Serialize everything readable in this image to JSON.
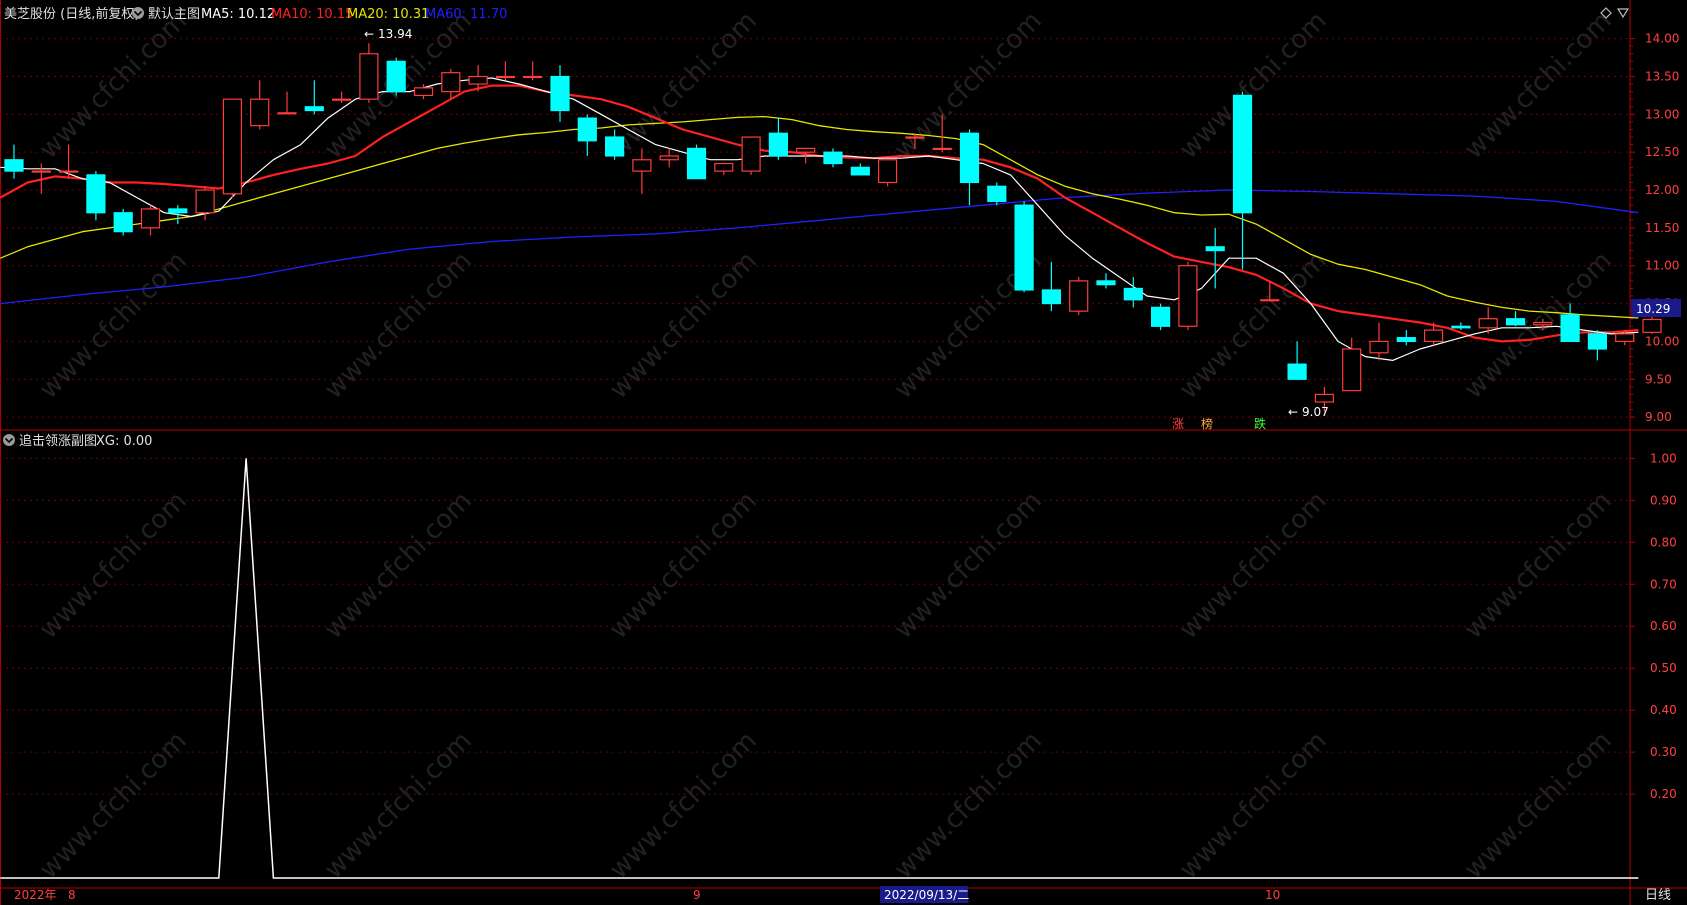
{
  "main_panel": {
    "stock_title": "美芝股份 (日线,前复权)",
    "template_label": "默认主图",
    "ma5": "MA5: 10.12",
    "ma10": "MA10: 10.15",
    "ma20": "MA20: 10.31",
    "ma60": "MA60: 11.70",
    "current_price_tag": "10.29",
    "high_marker": "13.94",
    "low_marker": "9.07",
    "signals": [
      "涨",
      "榜",
      "跌"
    ]
  },
  "sub_panel": {
    "title": "追击领涨副图",
    "value_label": "XG: 0.00"
  },
  "x_axis": {
    "labels": [
      "2022年",
      "8",
      "9",
      "10"
    ],
    "highlight_date": "2022/09/13/二",
    "period_button": "日线"
  },
  "watermark": "www.cfchi.com",
  "colors": {
    "up": "#ff3b3b",
    "down": "#00ffff",
    "ma5": "#ffffff",
    "ma10": "#ff2020",
    "ma20": "#e6e600",
    "ma60": "#2020ff",
    "axis": "#b40000",
    "grid": "#6e0000"
  },
  "chart_data": [
    {
      "type": "candlestick",
      "y_ticks": [
        14.0,
        13.5,
        13.0,
        12.5,
        12.0,
        11.5,
        11.0,
        10.5,
        10.0,
        9.5,
        9.0
      ],
      "ylim": [
        8.83,
        14.18
      ],
      "candles": [
        {
          "o": 12.4,
          "h": 12.6,
          "l": 12.15,
          "c": 12.25
        },
        {
          "o": 12.25,
          "h": 12.35,
          "l": 11.95,
          "c": 12.25
        },
        {
          "o": 12.25,
          "h": 12.6,
          "l": 12.15,
          "c": 12.25
        },
        {
          "o": 12.2,
          "h": 12.25,
          "l": 11.6,
          "c": 11.7
        },
        {
          "o": 11.7,
          "h": 11.75,
          "l": 11.4,
          "c": 11.45
        },
        {
          "o": 11.5,
          "h": 11.8,
          "l": 11.4,
          "c": 11.75
        },
        {
          "o": 11.75,
          "h": 11.8,
          "l": 11.55,
          "c": 11.7
        },
        {
          "o": 11.7,
          "h": 12.05,
          "l": 11.6,
          "c": 12.0
        },
        {
          "o": 11.95,
          "h": 13.2,
          "l": 11.9,
          "c": 13.2
        },
        {
          "o": 12.85,
          "h": 13.45,
          "l": 12.8,
          "c": 13.2
        },
        {
          "o": 13.02,
          "h": 13.3,
          "l": 13.0,
          "c": 13.02
        },
        {
          "o": 13.1,
          "h": 13.45,
          "l": 13.0,
          "c": 13.05
        },
        {
          "o": 13.2,
          "h": 13.3,
          "l": 13.15,
          "c": 13.2
        },
        {
          "o": 13.2,
          "h": 13.94,
          "l": 13.15,
          "c": 13.8
        },
        {
          "o": 13.7,
          "h": 13.75,
          "l": 13.25,
          "c": 13.3
        },
        {
          "o": 13.25,
          "h": 13.4,
          "l": 13.2,
          "c": 13.35
        },
        {
          "o": 13.3,
          "h": 13.6,
          "l": 13.2,
          "c": 13.55
        },
        {
          "o": 13.4,
          "h": 13.65,
          "l": 13.3,
          "c": 13.5
        },
        {
          "o": 13.5,
          "h": 13.7,
          "l": 13.45,
          "c": 13.5
        },
        {
          "o": 13.5,
          "h": 13.7,
          "l": 13.45,
          "c": 13.5
        },
        {
          "o": 13.5,
          "h": 13.65,
          "l": 12.9,
          "c": 13.05
        },
        {
          "o": 12.95,
          "h": 13.0,
          "l": 12.45,
          "c": 12.65
        },
        {
          "o": 12.7,
          "h": 12.8,
          "l": 12.4,
          "c": 12.45
        },
        {
          "o": 12.25,
          "h": 12.55,
          "l": 11.95,
          "c": 12.4
        },
        {
          "o": 12.4,
          "h": 12.55,
          "l": 12.3,
          "c": 12.45
        },
        {
          "o": 12.55,
          "h": 12.6,
          "l": 12.15,
          "c": 12.15
        },
        {
          "o": 12.25,
          "h": 12.3,
          "l": 12.2,
          "c": 12.35
        },
        {
          "o": 12.25,
          "h": 12.7,
          "l": 12.2,
          "c": 12.7
        },
        {
          "o": 12.75,
          "h": 12.95,
          "l": 12.4,
          "c": 12.45
        },
        {
          "o": 12.5,
          "h": 12.55,
          "l": 12.35,
          "c": 12.55
        },
        {
          "o": 12.5,
          "h": 12.55,
          "l": 12.3,
          "c": 12.35
        },
        {
          "o": 12.3,
          "h": 12.35,
          "l": 12.2,
          "c": 12.2
        },
        {
          "o": 12.1,
          "h": 12.4,
          "l": 12.05,
          "c": 12.4
        },
        {
          "o": 12.7,
          "h": 12.75,
          "l": 12.55,
          "c": 12.7
        },
        {
          "o": 12.55,
          "h": 13.0,
          "l": 12.5,
          "c": 12.55
        },
        {
          "o": 12.75,
          "h": 12.8,
          "l": 11.8,
          "c": 12.1
        },
        {
          "o": 12.05,
          "h": 12.1,
          "l": 11.8,
          "c": 11.85
        },
        {
          "o": 11.8,
          "h": 11.85,
          "l": 10.65,
          "c": 10.68
        },
        {
          "o": 10.68,
          "h": 11.05,
          "l": 10.4,
          "c": 10.5
        },
        {
          "o": 10.4,
          "h": 10.85,
          "l": 10.35,
          "c": 10.8
        },
        {
          "o": 10.8,
          "h": 10.9,
          "l": 10.7,
          "c": 10.75
        },
        {
          "o": 10.7,
          "h": 10.85,
          "l": 10.45,
          "c": 10.55
        },
        {
          "o": 10.45,
          "h": 10.5,
          "l": 10.15,
          "c": 10.2
        },
        {
          "o": 10.2,
          "h": 11.05,
          "l": 10.15,
          "c": 11.0
        },
        {
          "o": 11.25,
          "h": 11.5,
          "l": 10.7,
          "c": 11.2
        },
        {
          "o": 13.25,
          "h": 13.3,
          "l": 10.95,
          "c": 11.7
        },
        {
          "o": 10.55,
          "h": 10.8,
          "l": 10.55,
          "c": 10.55
        },
        {
          "o": 9.7,
          "h": 10.0,
          "l": 9.5,
          "c": 9.5
        },
        {
          "o": 9.2,
          "h": 9.4,
          "l": 9.07,
          "c": 9.3
        },
        {
          "o": 9.35,
          "h": 10.05,
          "l": 9.35,
          "c": 9.9
        },
        {
          "o": 9.85,
          "h": 10.25,
          "l": 9.75,
          "c": 10.0
        },
        {
          "o": 10.05,
          "h": 10.15,
          "l": 9.95,
          "c": 10.0
        },
        {
          "o": 10.0,
          "h": 10.25,
          "l": 9.95,
          "c": 10.15
        },
        {
          "o": 10.2,
          "h": 10.25,
          "l": 10.15,
          "c": 10.18
        },
        {
          "o": 10.18,
          "h": 10.45,
          "l": 10.1,
          "c": 10.3
        },
        {
          "o": 10.3,
          "h": 10.4,
          "l": 10.2,
          "c": 10.22
        },
        {
          "o": 10.22,
          "h": 10.3,
          "l": 10.15,
          "c": 10.25
        },
        {
          "o": 10.35,
          "h": 10.5,
          "l": 10.0,
          "c": 10.0
        },
        {
          "o": 10.1,
          "h": 10.15,
          "l": 9.75,
          "c": 9.9
        },
        {
          "o": 10.0,
          "h": 10.15,
          "l": 9.95,
          "c": 10.1
        },
        {
          "o": 10.12,
          "h": 10.35,
          "l": 10.1,
          "c": 10.29
        }
      ],
      "ma5_points": [
        [
          -0.5,
          12.3
        ],
        [
          0.5,
          12.28
        ],
        [
          1.5,
          12.28
        ],
        [
          2.5,
          12.15
        ],
        [
          3.5,
          12.1
        ],
        [
          4.5,
          11.9
        ],
        [
          5.5,
          11.7
        ],
        [
          6.5,
          11.65
        ],
        [
          7.5,
          11.72
        ],
        [
          8.5,
          12.1
        ],
        [
          9.5,
          12.4
        ],
        [
          10.5,
          12.6
        ],
        [
          11.5,
          12.95
        ],
        [
          12.5,
          13.2
        ],
        [
          13.5,
          13.3
        ],
        [
          14.5,
          13.3
        ],
        [
          15.5,
          13.4
        ],
        [
          16.5,
          13.45
        ],
        [
          17.5,
          13.48
        ],
        [
          18.5,
          13.4
        ],
        [
          19.5,
          13.3
        ],
        [
          20.5,
          13.2
        ],
        [
          21.5,
          13.0
        ],
        [
          22.5,
          12.8
        ],
        [
          23.5,
          12.6
        ],
        [
          24.5,
          12.5
        ],
        [
          25.5,
          12.4
        ],
        [
          26.5,
          12.4
        ],
        [
          27.5,
          12.45
        ],
        [
          28.5,
          12.45
        ],
        [
          29.5,
          12.45
        ],
        [
          30.5,
          12.45
        ],
        [
          31.5,
          12.42
        ],
        [
          32.5,
          12.42
        ],
        [
          33.5,
          12.45
        ],
        [
          34.5,
          12.4
        ],
        [
          35.5,
          12.35
        ],
        [
          36.5,
          12.2
        ],
        [
          37.5,
          11.8
        ],
        [
          38.5,
          11.4
        ],
        [
          39.5,
          11.1
        ],
        [
          40.5,
          10.85
        ],
        [
          41.5,
          10.6
        ],
        [
          42.5,
          10.55
        ],
        [
          43.5,
          10.7
        ],
        [
          44.5,
          11.1
        ],
        [
          45.5,
          11.1
        ],
        [
          46.5,
          10.9
        ],
        [
          47.5,
          10.5
        ],
        [
          48.5,
          10.0
        ],
        [
          49.5,
          9.8
        ],
        [
          50.5,
          9.75
        ],
        [
          51.5,
          9.9
        ],
        [
          52.5,
          10.0
        ],
        [
          53.5,
          10.1
        ],
        [
          54.5,
          10.18
        ],
        [
          55.5,
          10.18
        ],
        [
          56.5,
          10.2
        ],
        [
          57.5,
          10.15
        ],
        [
          58.5,
          10.1
        ],
        [
          59.5,
          10.12
        ]
      ],
      "ma10_points": [
        [
          -0.5,
          11.9
        ],
        [
          0.5,
          12.1
        ],
        [
          1.5,
          12.18
        ],
        [
          2.5,
          12.15
        ],
        [
          3.5,
          12.1
        ],
        [
          4.5,
          12.1
        ],
        [
          5.5,
          12.08
        ],
        [
          6.5,
          12.05
        ],
        [
          7.5,
          12.02
        ],
        [
          8.5,
          12.1
        ],
        [
          9.5,
          12.2
        ],
        [
          10.5,
          12.28
        ],
        [
          11.5,
          12.35
        ],
        [
          12.5,
          12.45
        ],
        [
          13.5,
          12.7
        ],
        [
          14.5,
          12.9
        ],
        [
          15.5,
          13.1
        ],
        [
          16.5,
          13.3
        ],
        [
          17.5,
          13.38
        ],
        [
          18.5,
          13.38
        ],
        [
          19.5,
          13.3
        ],
        [
          20.5,
          13.25
        ],
        [
          21.5,
          13.2
        ],
        [
          22.5,
          13.1
        ],
        [
          23.5,
          12.95
        ],
        [
          24.5,
          12.8
        ],
        [
          25.5,
          12.7
        ],
        [
          26.5,
          12.6
        ],
        [
          27.5,
          12.52
        ],
        [
          28.5,
          12.5
        ],
        [
          29.5,
          12.45
        ],
        [
          30.5,
          12.43
        ],
        [
          31.5,
          12.42
        ],
        [
          32.5,
          12.45
        ],
        [
          33.5,
          12.45
        ],
        [
          34.5,
          12.42
        ],
        [
          35.5,
          12.4
        ],
        [
          36.5,
          12.3
        ],
        [
          37.5,
          12.15
        ],
        [
          38.5,
          11.9
        ],
        [
          39.5,
          11.7
        ],
        [
          40.5,
          11.5
        ],
        [
          41.5,
          11.3
        ],
        [
          42.5,
          11.12
        ],
        [
          43.5,
          11.05
        ],
        [
          44.5,
          10.98
        ],
        [
          45.5,
          10.88
        ],
        [
          46.5,
          10.7
        ],
        [
          47.5,
          10.5
        ],
        [
          48.5,
          10.4
        ],
        [
          49.5,
          10.35
        ],
        [
          50.5,
          10.3
        ],
        [
          51.5,
          10.25
        ],
        [
          52.5,
          10.18
        ],
        [
          53.5,
          10.05
        ],
        [
          54.5,
          10.0
        ],
        [
          55.5,
          10.02
        ],
        [
          56.5,
          10.08
        ],
        [
          57.5,
          10.12
        ],
        [
          58.5,
          10.12
        ],
        [
          59.5,
          10.15
        ]
      ],
      "ma20_points": [
        [
          -0.5,
          11.1
        ],
        [
          0.5,
          11.25
        ],
        [
          1.5,
          11.35
        ],
        [
          2.5,
          11.45
        ],
        [
          3.5,
          11.5
        ],
        [
          4.5,
          11.55
        ],
        [
          5.5,
          11.6
        ],
        [
          6.5,
          11.65
        ],
        [
          7.5,
          11.75
        ],
        [
          8.5,
          11.85
        ],
        [
          9.5,
          11.95
        ],
        [
          10.5,
          12.05
        ],
        [
          11.5,
          12.15
        ],
        [
          12.5,
          12.25
        ],
        [
          13.5,
          12.35
        ],
        [
          14.5,
          12.45
        ],
        [
          15.5,
          12.55
        ],
        [
          16.5,
          12.62
        ],
        [
          17.5,
          12.68
        ],
        [
          18.5,
          12.73
        ],
        [
          19.5,
          12.76
        ],
        [
          20.5,
          12.8
        ],
        [
          21.5,
          12.82
        ],
        [
          22.5,
          12.86
        ],
        [
          23.5,
          12.88
        ],
        [
          24.5,
          12.9
        ],
        [
          25.5,
          12.93
        ],
        [
          26.5,
          12.96
        ],
        [
          27.5,
          12.97
        ],
        [
          28.5,
          12.93
        ],
        [
          29.5,
          12.85
        ],
        [
          30.5,
          12.8
        ],
        [
          31.5,
          12.77
        ],
        [
          32.5,
          12.75
        ],
        [
          33.5,
          12.72
        ],
        [
          34.5,
          12.68
        ],
        [
          35.5,
          12.6
        ],
        [
          36.5,
          12.4
        ],
        [
          37.5,
          12.2
        ],
        [
          38.5,
          12.05
        ],
        [
          39.5,
          11.95
        ],
        [
          40.5,
          11.88
        ],
        [
          41.5,
          11.8
        ],
        [
          42.5,
          11.7
        ],
        [
          43.5,
          11.67
        ],
        [
          44.5,
          11.68
        ],
        [
          45.5,
          11.55
        ],
        [
          46.5,
          11.35
        ],
        [
          47.5,
          11.15
        ],
        [
          48.5,
          11.02
        ],
        [
          49.5,
          10.95
        ],
        [
          50.5,
          10.85
        ],
        [
          51.5,
          10.75
        ],
        [
          52.5,
          10.6
        ],
        [
          53.5,
          10.52
        ],
        [
          54.5,
          10.45
        ],
        [
          55.5,
          10.4
        ],
        [
          56.5,
          10.38
        ],
        [
          57.5,
          10.35
        ],
        [
          58.5,
          10.33
        ],
        [
          59.5,
          10.31
        ]
      ],
      "ma60_points": [
        [
          -0.5,
          10.5
        ],
        [
          2.5,
          10.62
        ],
        [
          5.5,
          10.72
        ],
        [
          8.5,
          10.85
        ],
        [
          11.5,
          11.05
        ],
        [
          14.5,
          11.22
        ],
        [
          17.5,
          11.32
        ],
        [
          20.5,
          11.38
        ],
        [
          23.5,
          11.42
        ],
        [
          26.5,
          11.5
        ],
        [
          29.5,
          11.6
        ],
        [
          32.5,
          11.7
        ],
        [
          35.5,
          11.8
        ],
        [
          38.5,
          11.9
        ],
        [
          41.5,
          11.96
        ],
        [
          44.5,
          12.0
        ],
        [
          47.5,
          11.98
        ],
        [
          50.5,
          11.95
        ],
        [
          53.5,
          11.92
        ],
        [
          56.5,
          11.85
        ],
        [
          59.5,
          11.7
        ]
      ]
    },
    {
      "type": "line",
      "name": "XG",
      "y_ticks": [
        1.0,
        0.9,
        0.8,
        0.7,
        0.6,
        0.5,
        0.4,
        0.3,
        0.2
      ],
      "ylim": [
        0,
        1.02
      ],
      "x": [
        -0.5,
        7.5,
        8.5,
        9.5,
        59.5
      ],
      "y": [
        0,
        0,
        1.0,
        0,
        0
      ]
    }
  ]
}
